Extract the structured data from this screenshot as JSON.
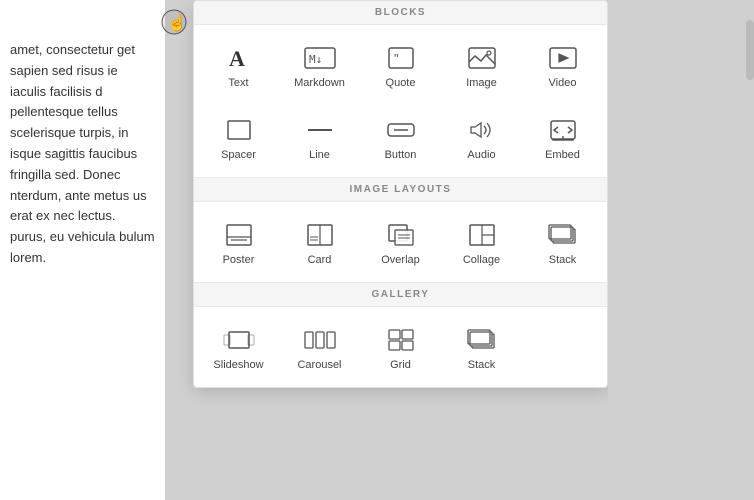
{
  "bg_text": "amet, consectetur get sapien sed risus ie iaculis facilisis d pellentesque tellus scelerisque turpis, in isque sagittis faucibus fringilla sed. Donec nterdum, ante metus us erat ex nec lectus. purus, eu vehicula bulum lorem.",
  "sections": [
    {
      "name": "blocks",
      "header": "BLOCKS",
      "items": [
        {
          "id": "text",
          "label": "Text"
        },
        {
          "id": "markdown",
          "label": "Markdown"
        },
        {
          "id": "quote",
          "label": "Quote"
        },
        {
          "id": "image",
          "label": "Image"
        },
        {
          "id": "video",
          "label": "Video"
        },
        {
          "id": "spacer",
          "label": "Spacer"
        },
        {
          "id": "line",
          "label": "Line"
        },
        {
          "id": "button",
          "label": "Button"
        },
        {
          "id": "audio",
          "label": "Audio"
        },
        {
          "id": "embed",
          "label": "Embed"
        }
      ]
    },
    {
      "name": "image-layouts",
      "header": "IMAGE LAYOUTS",
      "items": [
        {
          "id": "poster",
          "label": "Poster"
        },
        {
          "id": "card",
          "label": "Card"
        },
        {
          "id": "overlap",
          "label": "Overlap"
        },
        {
          "id": "collage",
          "label": "Collage"
        },
        {
          "id": "stack-img",
          "label": "Stack"
        }
      ]
    },
    {
      "name": "gallery",
      "header": "GALLERY",
      "items": [
        {
          "id": "slideshow",
          "label": "Slideshow"
        },
        {
          "id": "carousel",
          "label": "Carousel"
        },
        {
          "id": "grid",
          "label": "Grid"
        },
        {
          "id": "stack-gal",
          "label": "Stack"
        }
      ]
    }
  ]
}
